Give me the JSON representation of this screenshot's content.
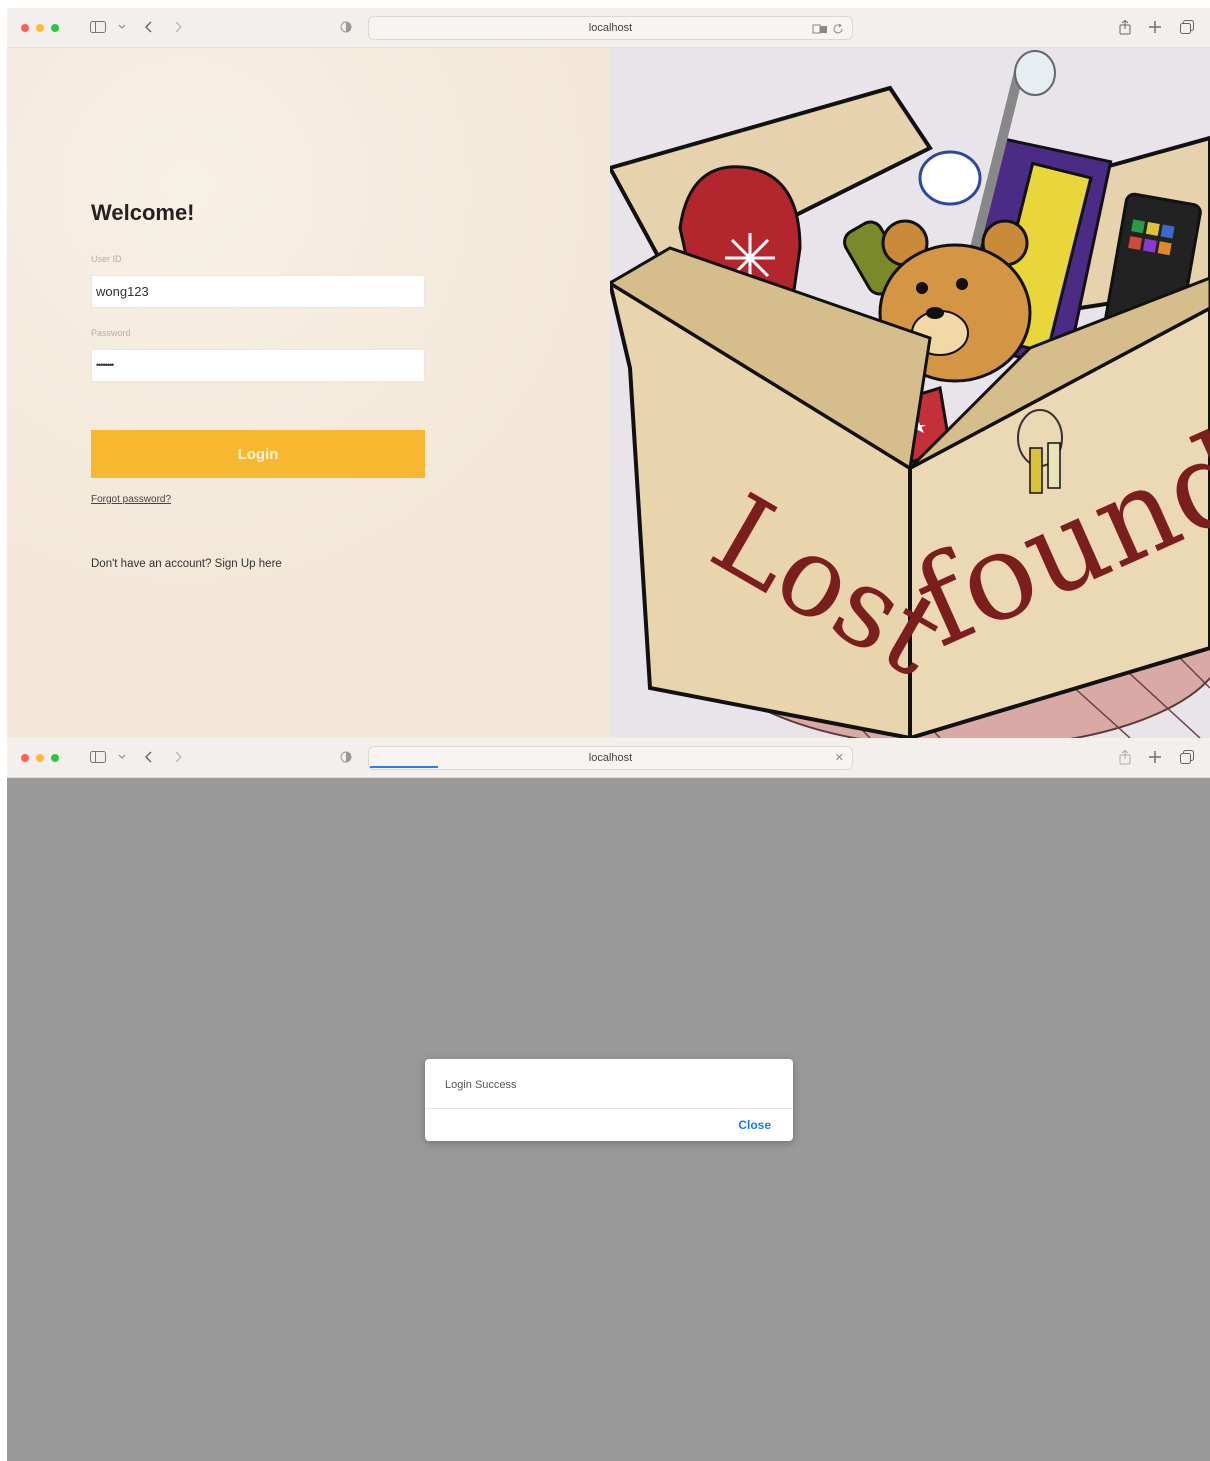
{
  "window_top": {
    "address": "localhost",
    "form": {
      "title": "Welcome!",
      "user_id_label": "User ID",
      "user_id_value": "wong123",
      "password_label": "Password",
      "password_value": "••••••••",
      "login_label": "Login",
      "forgot_label": "Forgot password?",
      "signup_text": "Don't have an account? Sign Up here"
    },
    "illustration": {
      "text_left": "Lost",
      "text_right": "found"
    }
  },
  "window_bottom": {
    "address": "localhost",
    "dialog": {
      "message": "Login Success",
      "close_label": "Close"
    }
  },
  "colors": {
    "accent": "#f7b731",
    "link_blue": "#1a7ae8",
    "left_bg": "#f3e8d8",
    "overlay": "#999999"
  }
}
